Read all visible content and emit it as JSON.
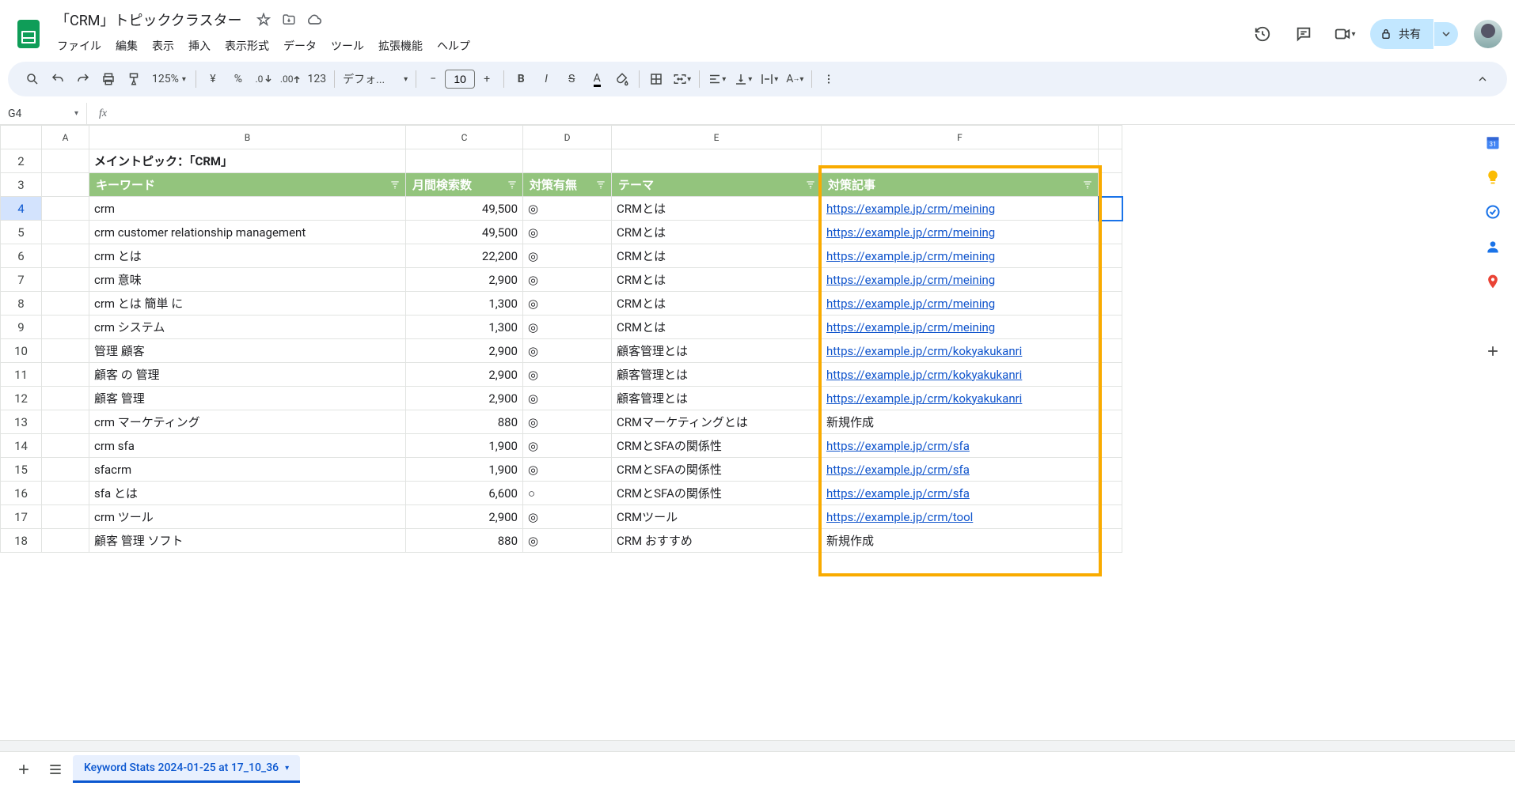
{
  "doc_title": "「CRM」トピッククラスター",
  "menus": [
    "ファイル",
    "編集",
    "表示",
    "挿入",
    "表示形式",
    "データ",
    "ツール",
    "拡張機能",
    "ヘルプ"
  ],
  "share_label": "共有",
  "toolbar": {
    "zoom": "125%",
    "currency": "¥",
    "percent": "%",
    "dec_dec": ".0",
    "inc_dec": ".00",
    "num_fmt": "123",
    "font": "デフォ...",
    "size": "10"
  },
  "name_box": "G4",
  "columns": [
    "A",
    "B",
    "C",
    "D",
    "E",
    "F"
  ],
  "main_topic": "メイントピック：「CRM」",
  "headers": {
    "keyword": "キーワード",
    "volume": "月間検索数",
    "status": "対策有無",
    "theme": "テーマ",
    "article": "対策記事"
  },
  "rows": [
    {
      "n": 4,
      "kw": "crm",
      "vol": "49,500",
      "st": "◎",
      "th": "CRMとは",
      "url": "https://example.jp/crm/meining",
      "link": true
    },
    {
      "n": 5,
      "kw": "crm customer relationship management",
      "vol": "49,500",
      "st": "◎",
      "th": "CRMとは",
      "url": "https://example.jp/crm/meining",
      "link": true
    },
    {
      "n": 6,
      "kw": "crm とは",
      "vol": "22,200",
      "st": "◎",
      "th": "CRMとは",
      "url": "https://example.jp/crm/meining",
      "link": true
    },
    {
      "n": 7,
      "kw": "crm 意味",
      "vol": "2,900",
      "st": "◎",
      "th": "CRMとは",
      "url": "https://example.jp/crm/meining",
      "link": true
    },
    {
      "n": 8,
      "kw": "crm とは 簡単 に",
      "vol": "1,300",
      "st": "◎",
      "th": "CRMとは",
      "url": "https://example.jp/crm/meining",
      "link": true
    },
    {
      "n": 9,
      "kw": "crm システム",
      "vol": "1,300",
      "st": "◎",
      "th": "CRMとは",
      "url": "https://example.jp/crm/meining",
      "link": true
    },
    {
      "n": 10,
      "kw": "管理 顧客",
      "vol": "2,900",
      "st": "◎",
      "th": "顧客管理とは",
      "url": "https://example.jp/crm/kokyakukanri",
      "link": true
    },
    {
      "n": 11,
      "kw": "顧客 の 管理",
      "vol": "2,900",
      "st": "◎",
      "th": "顧客管理とは",
      "url": "https://example.jp/crm/kokyakukanri",
      "link": true
    },
    {
      "n": 12,
      "kw": "顧客 管理",
      "vol": "2,900",
      "st": "◎",
      "th": "顧客管理とは",
      "url": "https://example.jp/crm/kokyakukanri",
      "link": true
    },
    {
      "n": 13,
      "kw": "crm マーケティング",
      "vol": "880",
      "st": "◎",
      "th": "CRMマーケティングとは",
      "url": "新規作成",
      "link": false
    },
    {
      "n": 14,
      "kw": "crm sfa",
      "vol": "1,900",
      "st": "◎",
      "th": "CRMとSFAの関係性",
      "url": "https://example.jp/crm/sfa",
      "link": true
    },
    {
      "n": 15,
      "kw": "sfacrm",
      "vol": "1,900",
      "st": "◎",
      "th": "CRMとSFAの関係性",
      "url": "https://example.jp/crm/sfa",
      "link": true
    },
    {
      "n": 16,
      "kw": "sfa とは",
      "vol": "6,600",
      "st": "○",
      "th": "CRMとSFAの関係性",
      "url": "https://example.jp/crm/sfa",
      "link": true
    },
    {
      "n": 17,
      "kw": "crm ツール",
      "vol": "2,900",
      "st": "◎",
      "th": "CRMツール",
      "url": "https://example.jp/crm/tool",
      "link": true
    },
    {
      "n": 18,
      "kw": "顧客 管理 ソフト",
      "vol": "880",
      "st": "◎",
      "th": "CRM おすすめ",
      "url": "新規作成",
      "link": false
    }
  ],
  "sheet_tab": "Keyword Stats 2024-01-25 at 17_10_36"
}
